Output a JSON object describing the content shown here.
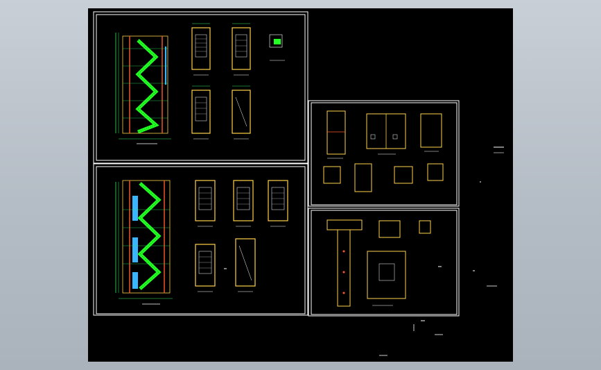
{
  "viewer": {
    "title": ""
  },
  "sheet": {
    "background": "#000000",
    "frame_color": "#ffffff",
    "stair_color": "#22ff22",
    "wall_color": "#ffd24a",
    "column_color": "#ff5a2a",
    "dim_color": "#33ee66",
    "accent_color": "#38b6ff"
  },
  "drawings": [
    {
      "id": "stair-section-1",
      "label": ""
    },
    {
      "id": "stair-plans-1",
      "label": ""
    },
    {
      "id": "stair-section-2",
      "label": ""
    },
    {
      "id": "stair-plans-2",
      "label": ""
    },
    {
      "id": "toilet-plans",
      "label": ""
    },
    {
      "id": "detail-plans",
      "label": ""
    }
  ]
}
